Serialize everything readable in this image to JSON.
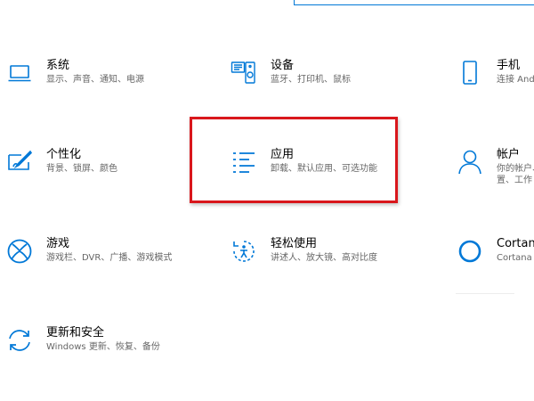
{
  "accent_color": "#0078d7",
  "highlight_color": "#d9171c",
  "tiles": {
    "system": {
      "icon": "laptop-icon",
      "title": "系统",
      "desc": "显示、声音、通知、电源"
    },
    "devices": {
      "icon": "devices-icon",
      "title": "设备",
      "desc": "蓝牙、打印机、鼠标"
    },
    "phone": {
      "icon": "phone-icon",
      "title": "手机",
      "desc": "连接 Andr"
    },
    "personal": {
      "icon": "personalization-icon",
      "title": "个性化",
      "desc": "背景、锁屏、颜色"
    },
    "apps": {
      "icon": "apps-list-icon",
      "title": "应用",
      "desc": "卸载、默认应用、可选功能"
    },
    "accounts": {
      "icon": "person-icon",
      "title": "帐户",
      "desc": "你的帐户、",
      "desc2": "置、工作"
    },
    "gaming": {
      "icon": "xbox-icon",
      "title": "游戏",
      "desc": "游戏栏、DVR、广播、游戏模式"
    },
    "ease": {
      "icon": "ease-of-access-icon",
      "title": "轻松使用",
      "desc": "讲述人、放大镜、高对比度"
    },
    "cortana": {
      "icon": "cortana-icon",
      "title": "Cortana",
      "desc": "Cortana 语"
    },
    "update": {
      "icon": "update-icon",
      "title": "更新和安全",
      "desc": "Windows 更新、恢复、备份"
    }
  }
}
